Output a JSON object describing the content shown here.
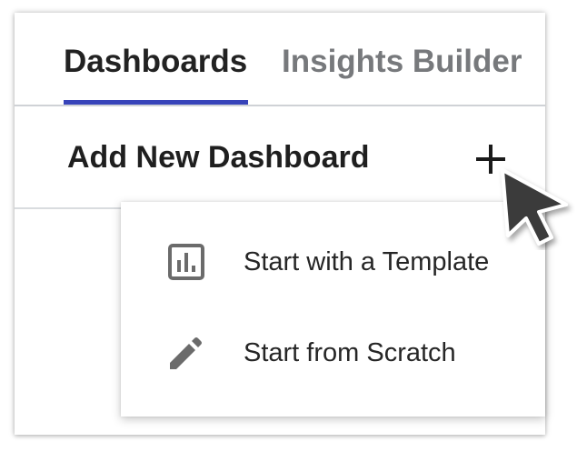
{
  "tabs": [
    {
      "label": "Dashboards",
      "active": true
    },
    {
      "label": "Insights Builder",
      "active": false
    }
  ],
  "add_section": {
    "title": "Add New Dashboard",
    "add_icon": "plus-icon"
  },
  "menu": {
    "items": [
      {
        "label": "Start with a Template",
        "icon": "bar-chart-icon"
      },
      {
        "label": "Start from Scratch",
        "icon": "pencil-icon"
      }
    ]
  },
  "colors": {
    "active_tab_indicator": "#3743b9",
    "active_tab_text": "#222222",
    "inactive_tab_text": "#77797c",
    "icon_gray": "#6b6b6b"
  }
}
